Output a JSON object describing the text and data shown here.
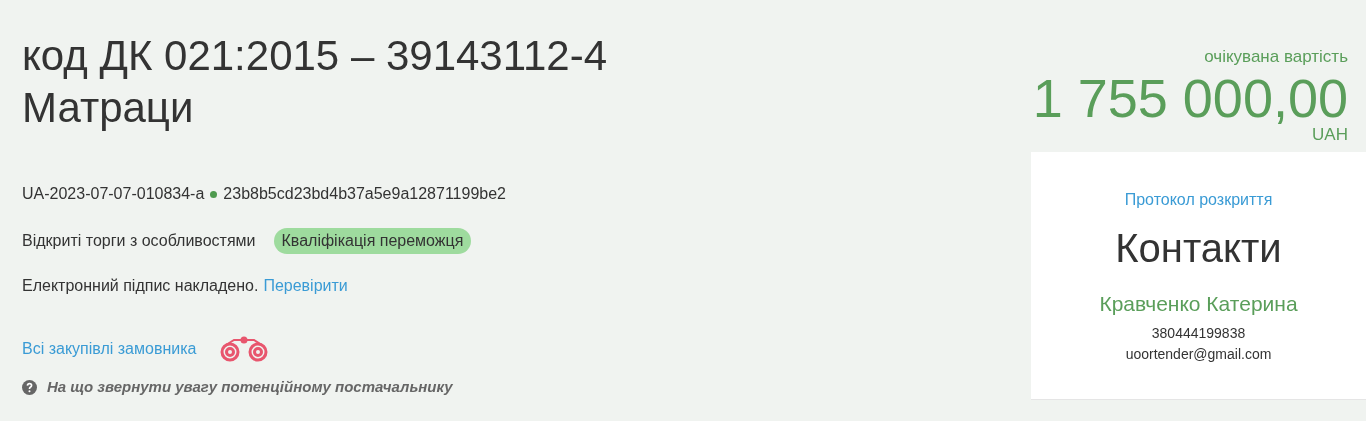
{
  "title": {
    "line_1": "код ДК 021:2015 – 39143112-4",
    "line_2": "Матраци"
  },
  "ids": {
    "tender_id": "UA-2023-07-07-010834-a",
    "hash": "23b8b5cd23bd4b37a5e9a12871199be2"
  },
  "procedure": {
    "type": "Відкриті торги з особливостями",
    "status": "Кваліфікація переможця"
  },
  "signature": {
    "text": "Електронний підпис накладено.",
    "link": "Перевірити"
  },
  "buyer_link": "Всі закупівлі замовника",
  "hint": "На що звернути увагу потенційному постачальнику",
  "value": {
    "label": "очікувана вартість",
    "amount": "1 755 000,00",
    "currency": "UAH"
  },
  "contacts": {
    "protocol_link": "Протокол розкриття",
    "heading": "Контакти",
    "name": "Кравченко Катерина",
    "phone": "380444199838",
    "email": "uoortender@gmail.com"
  }
}
